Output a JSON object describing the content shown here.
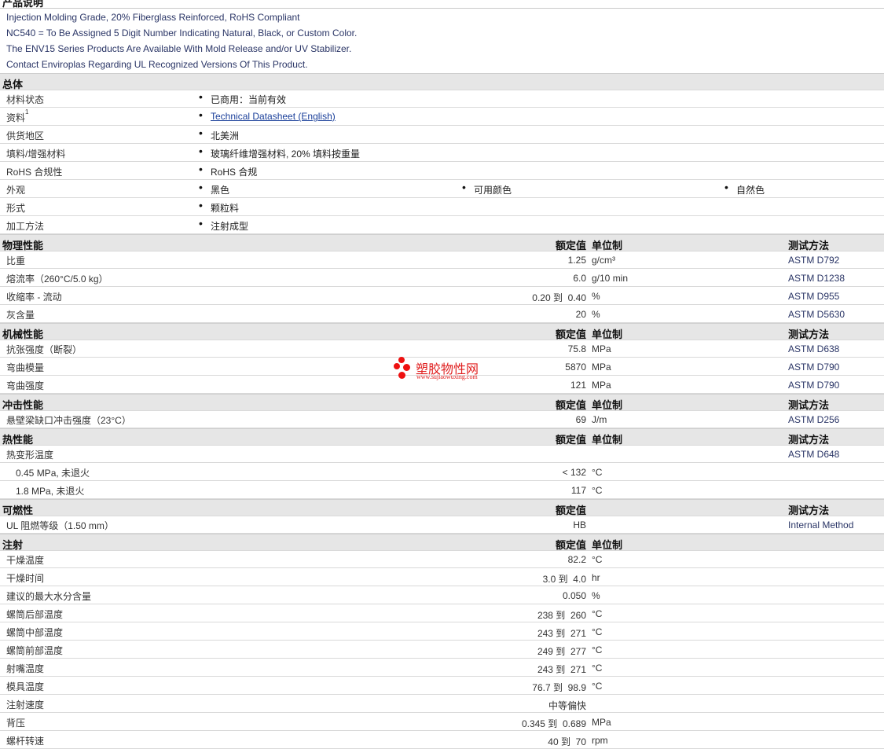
{
  "top_section_title": "产品说明",
  "description": [
    "Injection Molding Grade, 20% Fiberglass Reinforced, RoHS Compliant",
    "NC540 = To Be Assigned 5 Digit Number Indicating Natural, Black, or Custom Color.",
    "The ENV15 Series Products Are Available With Mold Release and/or UV Stabilizer.",
    "Contact Enviroplas Regarding UL Recognized Versions Of This Product."
  ],
  "general": {
    "title": "总体",
    "rows": [
      {
        "label": "材料状态",
        "items": [
          "已商用：当前有效"
        ]
      },
      {
        "label": "资料",
        "sup": "1",
        "items": [
          "Technical Datasheet (English)"
        ],
        "link": true
      },
      {
        "label": "供货地区",
        "items": [
          "北美洲"
        ]
      },
      {
        "label": "填料/增强材料",
        "items": [
          "玻璃纤维增强材料, 20% 填料按重量"
        ]
      },
      {
        "label": "RoHS 合规性",
        "items": [
          "RoHS 合规"
        ]
      },
      {
        "label": "外观",
        "items": [
          "黑色",
          "可用颜色",
          "自然色"
        ]
      },
      {
        "label": "形式",
        "items": [
          "颗粒料"
        ]
      },
      {
        "label": "加工方法",
        "items": [
          "注射成型"
        ]
      }
    ]
  },
  "headers": {
    "value": "额定值",
    "unit": "单位制",
    "test": "测试方法"
  },
  "sections": [
    {
      "title": "物理性能",
      "rows": [
        {
          "label": "比重",
          "value": "1.25",
          "unit": "g/cm³",
          "test": "ASTM D792"
        },
        {
          "label": "熔流率（260°C/5.0 kg）",
          "value": "6.0",
          "unit": "g/10 min",
          "test": "ASTM D1238"
        },
        {
          "label": "收缩率 - 流动",
          "value": "0.20 到  0.40",
          "unit": "%",
          "test": "ASTM D955"
        },
        {
          "label": "灰含量",
          "value": "20",
          "unit": "%",
          "test": "ASTM D5630"
        }
      ]
    },
    {
      "title": "机械性能",
      "rows": [
        {
          "label": "抗张强度（断裂）",
          "value": "75.8",
          "unit": "MPa",
          "test": "ASTM D638"
        },
        {
          "label": "弯曲模量",
          "value": "5870",
          "unit": "MPa",
          "test": "ASTM D790"
        },
        {
          "label": "弯曲强度",
          "value": "121",
          "unit": "MPa",
          "test": "ASTM D790"
        }
      ]
    },
    {
      "title": "冲击性能",
      "rows": [
        {
          "label": "悬壁梁缺口冲击强度（23°C）",
          "value": "69",
          "unit": "J/m",
          "test": "ASTM D256"
        }
      ]
    },
    {
      "title": "热性能",
      "rows": [
        {
          "label": "热变形温度",
          "value": "",
          "unit": "",
          "test": "ASTM D648"
        },
        {
          "label": "0.45 MPa, 未退火",
          "indent": true,
          "value": "< 132",
          "unit": "°C",
          "test": ""
        },
        {
          "label": "1.8 MPa, 未退火",
          "indent": true,
          "value": "117",
          "unit": "°C",
          "test": ""
        }
      ]
    },
    {
      "title": "可燃性",
      "no_unit": true,
      "rows": [
        {
          "label": "UL 阻燃等级（1.50 mm）",
          "value": "HB",
          "unit": "",
          "test": "Internal Method"
        }
      ]
    },
    {
      "title": "注射",
      "no_test": true,
      "rows": [
        {
          "label": "干燥温度",
          "value": "82.2",
          "unit": "°C",
          "test": ""
        },
        {
          "label": "干燥时间",
          "value": "3.0 到  4.0",
          "unit": "hr",
          "test": ""
        },
        {
          "label": "建议的最大水分含量",
          "value": "0.050",
          "unit": "%",
          "test": ""
        },
        {
          "label": "螺筒后部温度",
          "value": "238 到  260",
          "unit": "°C",
          "test": ""
        },
        {
          "label": "螺筒中部温度",
          "value": "243 到  271",
          "unit": "°C",
          "test": ""
        },
        {
          "label": "螺筒前部温度",
          "value": "249 到  277",
          "unit": "°C",
          "test": ""
        },
        {
          "label": "射嘴温度",
          "value": "243 到  271",
          "unit": "°C",
          "test": ""
        },
        {
          "label": "模具温度",
          "value": "76.7 到  98.9",
          "unit": "°C",
          "test": ""
        },
        {
          "label": "注射速度",
          "value": "中等偏快",
          "unit": "",
          "test": ""
        },
        {
          "label": "背压",
          "value": "0.345 到  0.689",
          "unit": "MPa",
          "test": ""
        },
        {
          "label": "螺杆转速",
          "value": "40 到  70",
          "unit": "rpm",
          "test": ""
        }
      ]
    }
  ],
  "watermark": {
    "cn": "塑胶物性网",
    "url": "www.sujiaowuxing.com"
  }
}
